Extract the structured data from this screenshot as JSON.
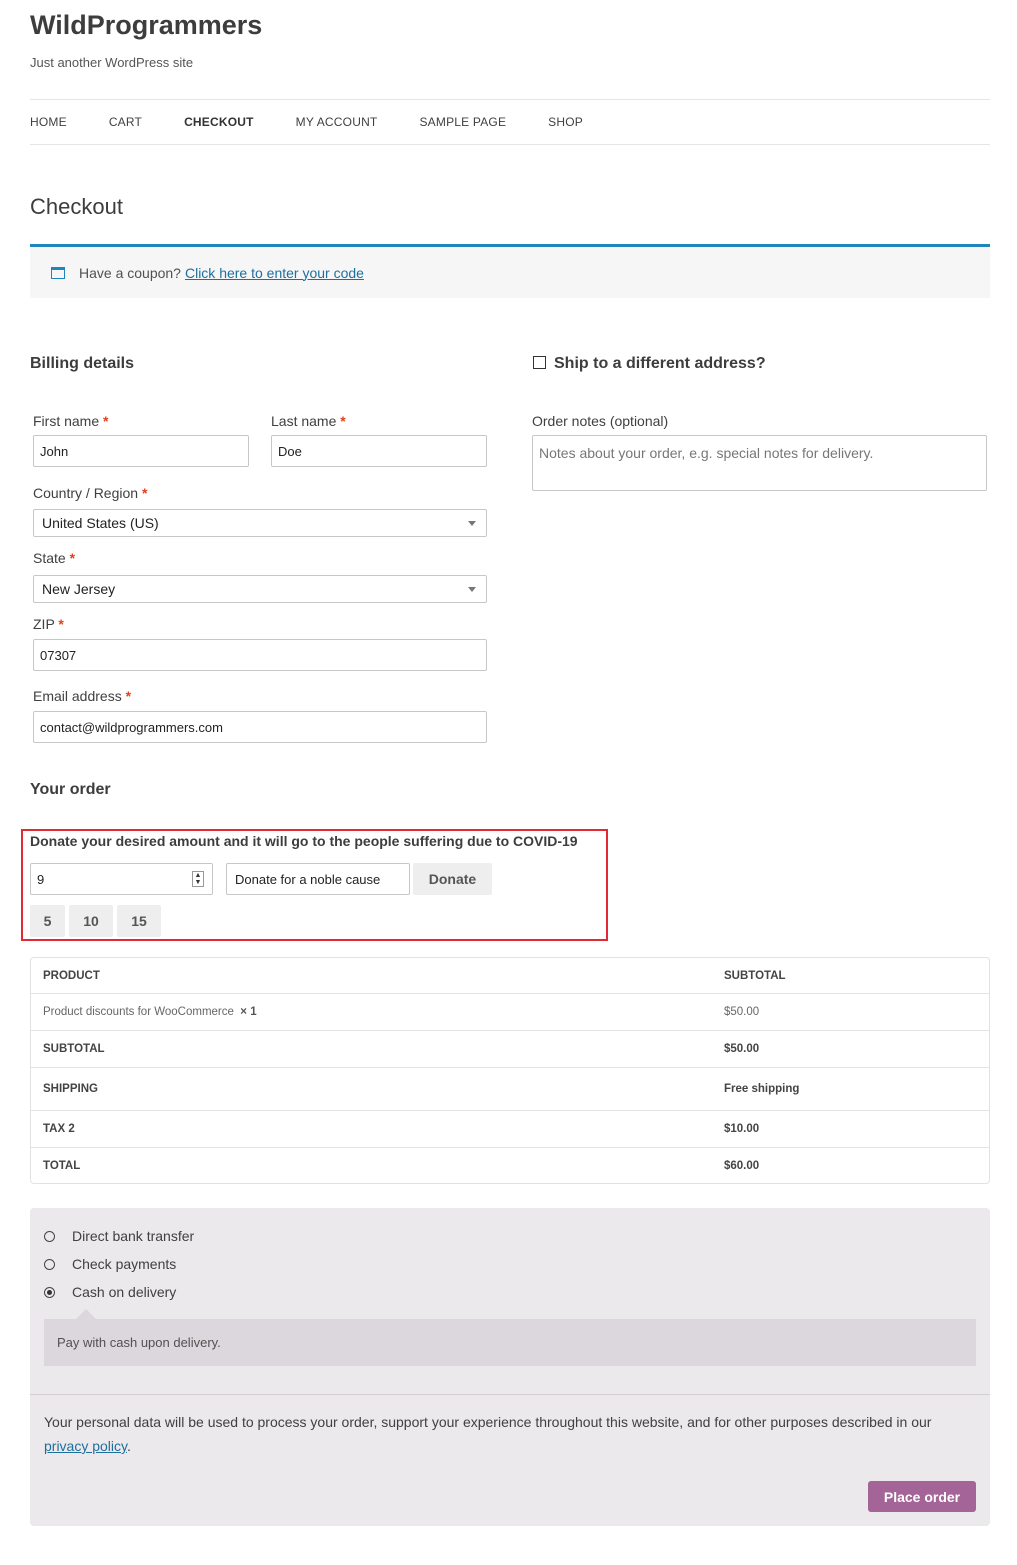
{
  "site": {
    "title": "WildProgrammers",
    "tagline": "Just another WordPress site"
  },
  "nav": [
    "HOME",
    "CART",
    "CHECKOUT",
    "MY ACCOUNT",
    "SAMPLE PAGE",
    "SHOP"
  ],
  "page_title": "Checkout",
  "coupon": {
    "text": "Have a coupon?",
    "link": "Click here to enter your code"
  },
  "billing": {
    "heading": "Billing details",
    "first_name": {
      "label": "First name",
      "value": "John"
    },
    "last_name": {
      "label": "Last name",
      "value": "Doe"
    },
    "country": {
      "label": "Country / Region",
      "value": "United States (US)"
    },
    "state": {
      "label": "State",
      "value": "New Jersey"
    },
    "zip": {
      "label": "ZIP",
      "value": "07307"
    },
    "email": {
      "label": "Email address",
      "value": "contact@wildprogrammers.com"
    },
    "required_mark": "*"
  },
  "shipping": {
    "ship_label": "Ship to a different address?",
    "notes_label": "Order notes (optional)",
    "notes_placeholder": "Notes about your order, e.g. special notes for delivery."
  },
  "order": {
    "heading": "Your order",
    "donation": {
      "title": "Donate your desired amount and it will go to the people suffering due to COVID-19",
      "amount": "9",
      "cause": "Donate for a noble cause",
      "button": "Donate",
      "presets": [
        "5",
        "10",
        "15"
      ]
    },
    "table": {
      "headers": [
        "PRODUCT",
        "SUBTOTAL"
      ],
      "product": {
        "name": "Product discounts for WooCommerce",
        "qty": "× 1",
        "price": "$50.00"
      },
      "subtotal": {
        "label": "SUBTOTAL",
        "value": "$50.00"
      },
      "shipping": {
        "label": "SHIPPING",
        "value": "Free shipping"
      },
      "tax": {
        "label": "TAX 2",
        "value": "$10.00"
      },
      "total": {
        "label": "TOTAL",
        "value": "$60.00"
      }
    }
  },
  "payment": {
    "methods": [
      "Direct bank transfer",
      "Check payments",
      "Cash on delivery"
    ],
    "selected": "Cash on delivery",
    "description": "Pay with cash upon delivery.",
    "privacy_text": "Your personal data will be used to process your order, support your experience throughout this website, and for other purposes described in our",
    "privacy_link": "privacy policy",
    "privacy_end": ".",
    "place_order": "Place order"
  },
  "colors": {
    "accent": "#1e85be",
    "place_order": "#a46497",
    "highlight": "#e02b36",
    "required": "#e2401c"
  }
}
